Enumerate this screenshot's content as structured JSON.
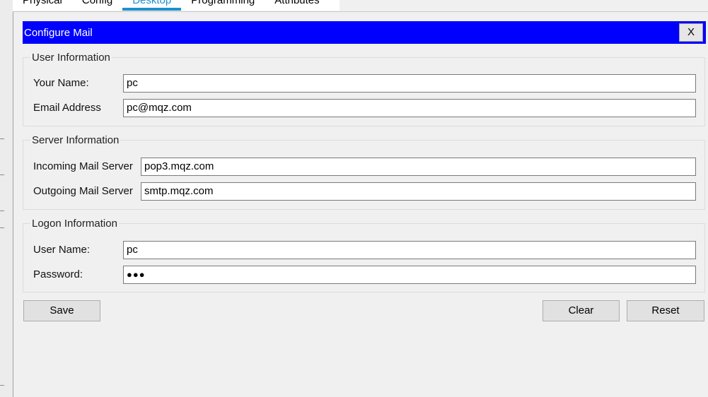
{
  "tabs": [
    {
      "label": "Physical"
    },
    {
      "label": "Config"
    },
    {
      "label": "Desktop"
    },
    {
      "label": "Programming"
    },
    {
      "label": "Attributes"
    }
  ],
  "dialog": {
    "title": "Configure Mail",
    "close_label": "X"
  },
  "user_info": {
    "legend": "User Information",
    "name_label": "Your Name:",
    "name_value": "pc",
    "email_label": "Email Address",
    "email_value": "pc@mqz.com"
  },
  "server_info": {
    "legend": "Server Information",
    "incoming_label": "Incoming Mail Server",
    "incoming_value": "pop3.mqz.com",
    "outgoing_label": "Outgoing Mail Server",
    "outgoing_value": "smtp.mqz.com"
  },
  "logon_info": {
    "legend": "Logon Information",
    "username_label": "User Name:",
    "username_value": "pc",
    "password_label": "Password:",
    "password_mask": "●●●"
  },
  "buttons": {
    "save": "Save",
    "clear": "Clear",
    "reset": "Reset"
  },
  "colors": {
    "titlebar": "#0000ff",
    "active_tab": "#1e90d0"
  }
}
